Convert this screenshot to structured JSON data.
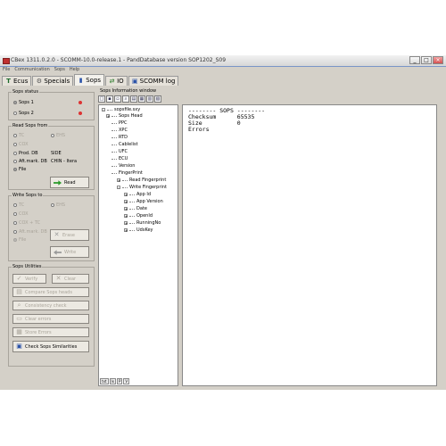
{
  "window": {
    "title": "CBex 1311.0.2.0 - SCOMM-10.0-release.1 - PandDatabase version SOP1202_S09",
    "controls": [
      "_",
      "□",
      "×"
    ]
  },
  "menu": [
    "File",
    "Communication",
    "Sops",
    "Help"
  ],
  "tabs": [
    {
      "label": "Ecus",
      "icon": "tt-icon"
    },
    {
      "label": "Specials",
      "icon": "gear-icon"
    },
    {
      "label": "Sops",
      "icon": "chart-icon",
      "active": true
    },
    {
      "label": "IO",
      "icon": "io-icon"
    },
    {
      "label": "SCOMM log",
      "icon": "log-icon"
    }
  ],
  "sops_status": {
    "legend": "Sops status",
    "items": [
      {
        "label": "Sops 1",
        "selected": true
      },
      {
        "label": "Sops 2",
        "selected": false
      }
    ]
  },
  "read_sops": {
    "legend": "Read Sops from",
    "items": [
      {
        "label": "TC",
        "enabled": false
      },
      {
        "label": "EHS",
        "enabled": false
      },
      {
        "label": "COX",
        "enabled": false
      },
      {
        "label": "Prod. DB",
        "enabled": true
      },
      {
        "label": "SIDE",
        "enabled": true
      },
      {
        "label": "Aft.mark. DB",
        "enabled": true
      },
      {
        "label": "CHIN - Itera",
        "enabled": true
      },
      {
        "label": "File",
        "enabled": true,
        "selected": true
      }
    ],
    "read_button": "Read"
  },
  "write_sops": {
    "legend": "Write Sops to",
    "items": [
      {
        "label": "TC"
      },
      {
        "label": "EHS"
      },
      {
        "label": "COX"
      },
      {
        "label": "COX + TC"
      },
      {
        "label": "Aft.mark. DB"
      },
      {
        "label": "File"
      }
    ],
    "erase_button": "Erase",
    "write_button": "Write"
  },
  "sops_utilities": {
    "legend": "Sops Utilities",
    "verify_button": "Verify",
    "clear_button": "Clear",
    "compare_button": "Compare Sops heads",
    "consistency_button": "Consistency check",
    "clear_errors_button": "Clear errors",
    "store_errors_button": "Store Errors",
    "check_button": "Check Sops Similarities"
  },
  "info_window": {
    "label": "Sops Information window",
    "tree": {
      "root": "sopsfile.sxy",
      "nodes": [
        {
          "label": "Sops Head",
          "level": 1,
          "expander": "+"
        },
        {
          "label": "PPC",
          "level": 1
        },
        {
          "label": "XPC",
          "level": 1
        },
        {
          "label": "RTD",
          "level": 1
        },
        {
          "label": "Cablelist",
          "level": 1
        },
        {
          "label": "UFC",
          "level": 1
        },
        {
          "label": "ECU",
          "level": 1
        },
        {
          "label": "Version",
          "level": 1
        },
        {
          "label": "FingerPrint",
          "level": 1,
          "expander": "-"
        },
        {
          "label": "Read Fingerprint",
          "level": 2,
          "expander": "+"
        },
        {
          "label": "Write Fingerprint",
          "level": 2,
          "expander": "-"
        },
        {
          "label": "App Id",
          "level": 3,
          "expander": "+"
        },
        {
          "label": "App Version",
          "level": 3,
          "expander": "+"
        },
        {
          "label": "Date",
          "level": 3,
          "expander": "+"
        },
        {
          "label": "OpenId",
          "level": 3,
          "expander": "+"
        },
        {
          "label": "RunningNo",
          "level": 3,
          "expander": "+"
        },
        {
          "label": "UdsKey",
          "level": 3,
          "expander": "+"
        }
      ]
    },
    "tree_tabs": [
      "txt",
      "lx",
      "P",
      "V"
    ],
    "text_lines": [
      "-------- SOPS --------",
      "Checksum      65535",
      "Size          0",
      "Errors"
    ]
  }
}
